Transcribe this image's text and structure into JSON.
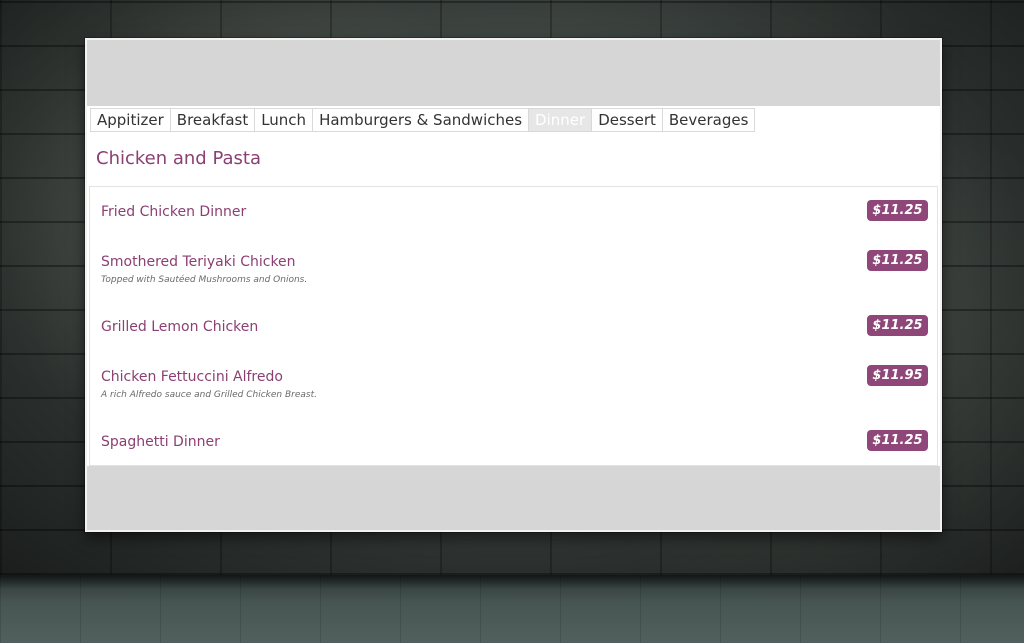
{
  "tabs": [
    {
      "label": "Appitizer",
      "active": false
    },
    {
      "label": "Breakfast",
      "active": false
    },
    {
      "label": "Lunch",
      "active": false
    },
    {
      "label": "Hamburgers & Sandwiches",
      "active": false
    },
    {
      "label": "Dinner",
      "active": true
    },
    {
      "label": "Dessert",
      "active": false
    },
    {
      "label": "Beverages",
      "active": false
    }
  ],
  "section_title": "Chicken and Pasta",
  "items": [
    {
      "name": "Fried Chicken Dinner",
      "price": "$11.25"
    },
    {
      "name": "Smothered Teriyaki Chicken",
      "desc": "Topped with Sautéed Mushrooms and Onions.",
      "price": "$11.25"
    },
    {
      "name": "Grilled Lemon Chicken",
      "price": "$11.25"
    },
    {
      "name": "Chicken Fettuccini Alfredo",
      "desc": "A rich Alfredo sauce and Grilled Chicken Breast.",
      "price": "$11.95"
    },
    {
      "name": "Spaghetti Dinner",
      "price": "$11.25"
    }
  ],
  "colors": {
    "accent": "#8b3f73",
    "price_badge": "#8e4778",
    "active_tab_bg": "#e6e6e6",
    "panel_frame": "#d6d6d6"
  }
}
